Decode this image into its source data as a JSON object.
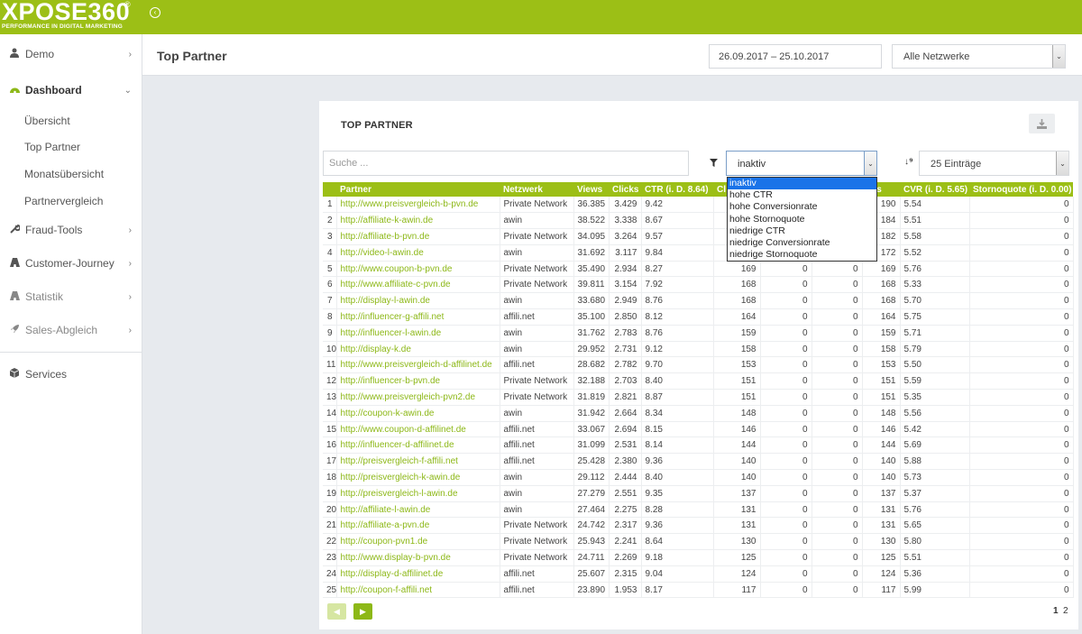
{
  "logo": {
    "main": "XPOSE360",
    "reg": "®",
    "tagline": "PERFORMANCE IN DIGITAL MARKETING"
  },
  "header": {
    "title": "Top Partner",
    "date_range": "26.09.2017 – 25.10.2017",
    "network_select": "Alle Netzwerke"
  },
  "sidebar": {
    "items": [
      {
        "label": "Demo",
        "icon": "user-icon"
      },
      {
        "label": "Dashboard",
        "icon": "dashboard-icon"
      },
      {
        "label": "Fraud-Tools",
        "icon": "wrench-icon"
      },
      {
        "label": "Customer-Journey",
        "icon": "road-icon"
      },
      {
        "label": "Statistik",
        "icon": "road-icon"
      },
      {
        "label": "Sales-Abgleich",
        "icon": "rocket-icon"
      },
      {
        "label": "Services",
        "icon": "cube-icon"
      }
    ],
    "subitems": [
      "Übersicht",
      "Top Partner",
      "Monatsübersicht",
      "Partnervergleich"
    ]
  },
  "card": {
    "title": "TOP PARTNER",
    "search_placeholder": "Suche ...",
    "filter_value": "inaktiv",
    "entries_value": "25 Einträge"
  },
  "filter_options": [
    "inaktiv",
    "hohe CTR",
    "hohe Conversionrate",
    "hohe Stornoquote",
    "niedrige CTR",
    "niedrige Conversionrate",
    "niedrige Stornoquote"
  ],
  "table": {
    "headers": [
      "",
      "Partner",
      "Netzwerk",
      "Views",
      "Clicks",
      "CTR (i. D. 8.64)",
      "Cl",
      "",
      "",
      "ons",
      "CVR (i. D. 5.65)",
      "Stornoquote (i. D. 0.00)"
    ],
    "rows": [
      [
        "1",
        "http://www.preisvergleich-b-pvn.de",
        "Private Network",
        "36.385",
        "3.429",
        "9.42",
        "",
        "",
        "",
        "190",
        "5.54",
        "0"
      ],
      [
        "2",
        "http://affiliate-k-awin.de",
        "awin",
        "38.522",
        "3.338",
        "8.67",
        "",
        "",
        "",
        "184",
        "5.51",
        "0"
      ],
      [
        "3",
        "http://affiliate-b-pvn.de",
        "Private Network",
        "34.095",
        "3.264",
        "9.57",
        "",
        "",
        "",
        "182",
        "5.58",
        "0"
      ],
      [
        "4",
        "http://video-l-awin.de",
        "awin",
        "31.692",
        "3.117",
        "9.84",
        "",
        "",
        "",
        "172",
        "5.52",
        "0"
      ],
      [
        "5",
        "http://www.coupon-b-pvn.de",
        "Private Network",
        "35.490",
        "2.934",
        "8.27",
        "169",
        "0",
        "0",
        "169",
        "5.76",
        "0"
      ],
      [
        "6",
        "http://www.affiliate-c-pvn.de",
        "Private Network",
        "39.811",
        "3.154",
        "7.92",
        "168",
        "0",
        "0",
        "168",
        "5.33",
        "0"
      ],
      [
        "7",
        "http://display-l-awin.de",
        "awin",
        "33.680",
        "2.949",
        "8.76",
        "168",
        "0",
        "0",
        "168",
        "5.70",
        "0"
      ],
      [
        "8",
        "http://influencer-g-affili.net",
        "affili.net",
        "35.100",
        "2.850",
        "8.12",
        "164",
        "0",
        "0",
        "164",
        "5.75",
        "0"
      ],
      [
        "9",
        "http://influencer-l-awin.de",
        "awin",
        "31.762",
        "2.783",
        "8.76",
        "159",
        "0",
        "0",
        "159",
        "5.71",
        "0"
      ],
      [
        "10",
        "http://display-k.de",
        "awin",
        "29.952",
        "2.731",
        "9.12",
        "158",
        "0",
        "0",
        "158",
        "5.79",
        "0"
      ],
      [
        "11",
        "http://www.preisvergleich-d-affilinet.de",
        "affili.net",
        "28.682",
        "2.782",
        "9.70",
        "153",
        "0",
        "0",
        "153",
        "5.50",
        "0"
      ],
      [
        "12",
        "http://influencer-b-pvn.de",
        "Private Network",
        "32.188",
        "2.703",
        "8.40",
        "151",
        "0",
        "0",
        "151",
        "5.59",
        "0"
      ],
      [
        "13",
        "http://www.preisvergleich-pvn2.de",
        "Private Network",
        "31.819",
        "2.821",
        "8.87",
        "151",
        "0",
        "0",
        "151",
        "5.35",
        "0"
      ],
      [
        "14",
        "http://coupon-k-awin.de",
        "awin",
        "31.942",
        "2.664",
        "8.34",
        "148",
        "0",
        "0",
        "148",
        "5.56",
        "0"
      ],
      [
        "15",
        "http://www.coupon-d-affilinet.de",
        "affili.net",
        "33.067",
        "2.694",
        "8.15",
        "146",
        "0",
        "0",
        "146",
        "5.42",
        "0"
      ],
      [
        "16",
        "http://influencer-d-affilinet.de",
        "affili.net",
        "31.099",
        "2.531",
        "8.14",
        "144",
        "0",
        "0",
        "144",
        "5.69",
        "0"
      ],
      [
        "17",
        "http://preisvergleich-f-affili.net",
        "affili.net",
        "25.428",
        "2.380",
        "9.36",
        "140",
        "0",
        "0",
        "140",
        "5.88",
        "0"
      ],
      [
        "18",
        "http://preisvergleich-k-awin.de",
        "awin",
        "29.112",
        "2.444",
        "8.40",
        "140",
        "0",
        "0",
        "140",
        "5.73",
        "0"
      ],
      [
        "19",
        "http://preisvergleich-l-awin.de",
        "awin",
        "27.279",
        "2.551",
        "9.35",
        "137",
        "0",
        "0",
        "137",
        "5.37",
        "0"
      ],
      [
        "20",
        "http://affiliate-l-awin.de",
        "awin",
        "27.464",
        "2.275",
        "8.28",
        "131",
        "0",
        "0",
        "131",
        "5.76",
        "0"
      ],
      [
        "21",
        "http://affiliate-a-pvn.de",
        "Private Network",
        "24.742",
        "2.317",
        "9.36",
        "131",
        "0",
        "0",
        "131",
        "5.65",
        "0"
      ],
      [
        "22",
        "http://coupon-pvn1.de",
        "Private Network",
        "25.943",
        "2.241",
        "8.64",
        "130",
        "0",
        "0",
        "130",
        "5.80",
        "0"
      ],
      [
        "23",
        "http://www.display-b-pvn.de",
        "Private Network",
        "24.711",
        "2.269",
        "9.18",
        "125",
        "0",
        "0",
        "125",
        "5.51",
        "0"
      ],
      [
        "24",
        "http://display-d-affilinet.de",
        "affili.net",
        "25.607",
        "2.315",
        "9.04",
        "124",
        "0",
        "0",
        "124",
        "5.36",
        "0"
      ],
      [
        "25",
        "http://coupon-f-affili.net",
        "affili.net",
        "23.890",
        "1.953",
        "8.17",
        "117",
        "0",
        "0",
        "117",
        "5.99",
        "0"
      ]
    ]
  },
  "pagination": {
    "pages": [
      "1",
      "2"
    ],
    "current": "1"
  },
  "colors": {
    "brand": "#9cbf16",
    "link": "#8db818",
    "selected_option": "#1a73e8"
  }
}
